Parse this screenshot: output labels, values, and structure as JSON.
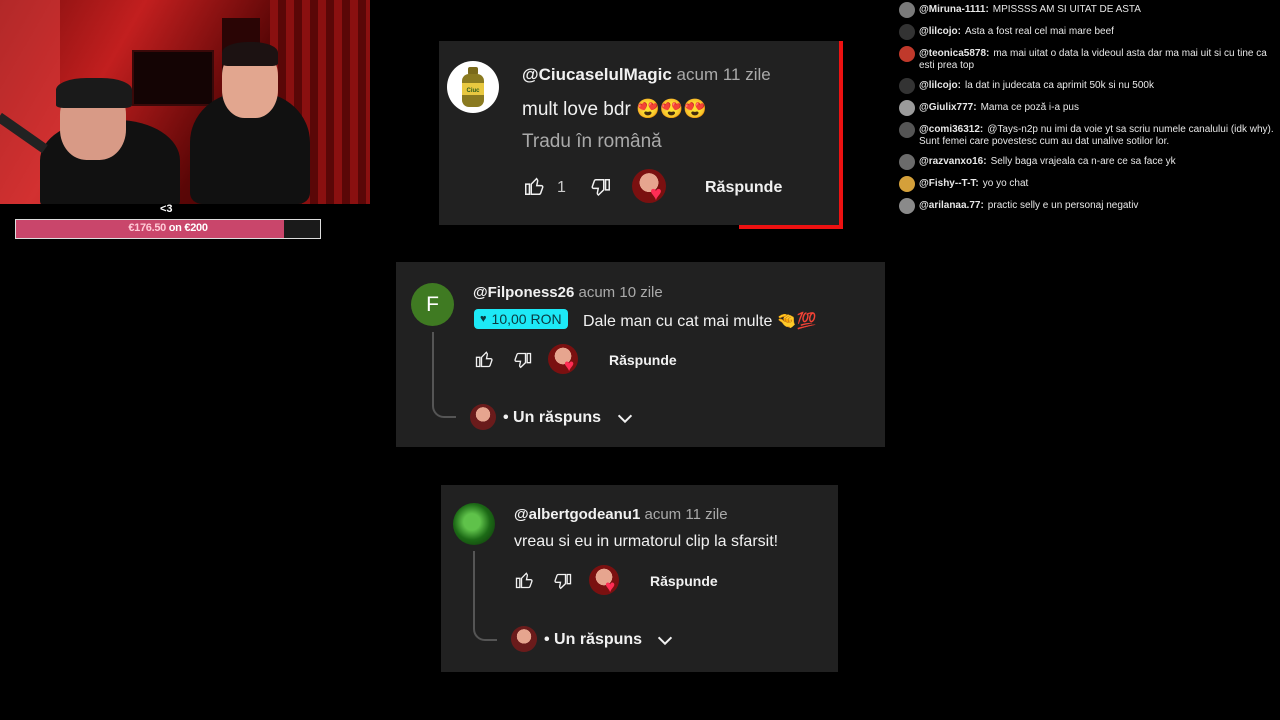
{
  "overlay": {
    "heart_text": "<3",
    "goal": {
      "current": "€176.50",
      "connector": "on",
      "target": "€200",
      "fraction": 0.8825
    }
  },
  "chat": [
    {
      "user": "@Miruna-1111:",
      "message": "MPISSSS AM SI UITAT DE ASTA",
      "avatar_color": "#7a7a7a"
    },
    {
      "user": "@lilcojo:",
      "message": "Asta a fost real cel mai mare beef",
      "avatar_color": "#333333"
    },
    {
      "user": "@teonica5878:",
      "message": "ma mai uitat o data la videoul asta dar ma mai uit si cu tine ca esti prea top",
      "avatar_color": "#c0392b"
    },
    {
      "user": "@lilcojo:",
      "message": "la dat in judecata ca aprimit 50k si nu 500k",
      "avatar_color": "#333333"
    },
    {
      "user": "@Giulix777:",
      "message": "Mama ce poză i-a pus",
      "avatar_color": "#9a9a9a"
    },
    {
      "user": "@comi36312:",
      "message": "@Tays-n2p nu imi da voie yt sa scriu numele canalului (idk why). Sunt femei care povestesc cum au dat unalive sotilor lor.",
      "avatar_color": "#555555"
    },
    {
      "user": "@razvanxo16:",
      "message": "Selly baga vrajeala ca n-are ce sa face yk",
      "avatar_color": "#6b6b6b"
    },
    {
      "user": "@Fishy--T-T:",
      "message": "yo yo chat",
      "avatar_color": "#d4a03a"
    },
    {
      "user": "@arilanaa.77:",
      "message": "practic selly e un personaj negativ",
      "avatar_color": "#8a8a8a"
    }
  ],
  "comments": [
    {
      "author": "@CiucaselulMagic",
      "time": "acum 11 zile",
      "text": "mult love bdr 😍😍😍",
      "translate": "Tradu în română",
      "likes": "1",
      "reply_label": "Răspunde"
    },
    {
      "author": "@Filponess26",
      "avatar_letter": "F",
      "time": "acum 10 zile",
      "donation": "10,00 RON",
      "text": "Dale man cu cat mai multe 🤏💯",
      "reply_label": "Răspunde",
      "replies_label": "• Un răspuns"
    },
    {
      "author": "@albertgodeanu1",
      "time": "acum 11 zile",
      "text": "vreau si eu in urmatorul clip la sfarsit!",
      "reply_label": "Răspunde",
      "replies_label": "• Un răspuns"
    }
  ],
  "colors": {
    "card_bg": "#212121",
    "accent_red": "#ee1111",
    "donation_bg": "#1de9f6",
    "goal_fill": "#c9466b"
  }
}
